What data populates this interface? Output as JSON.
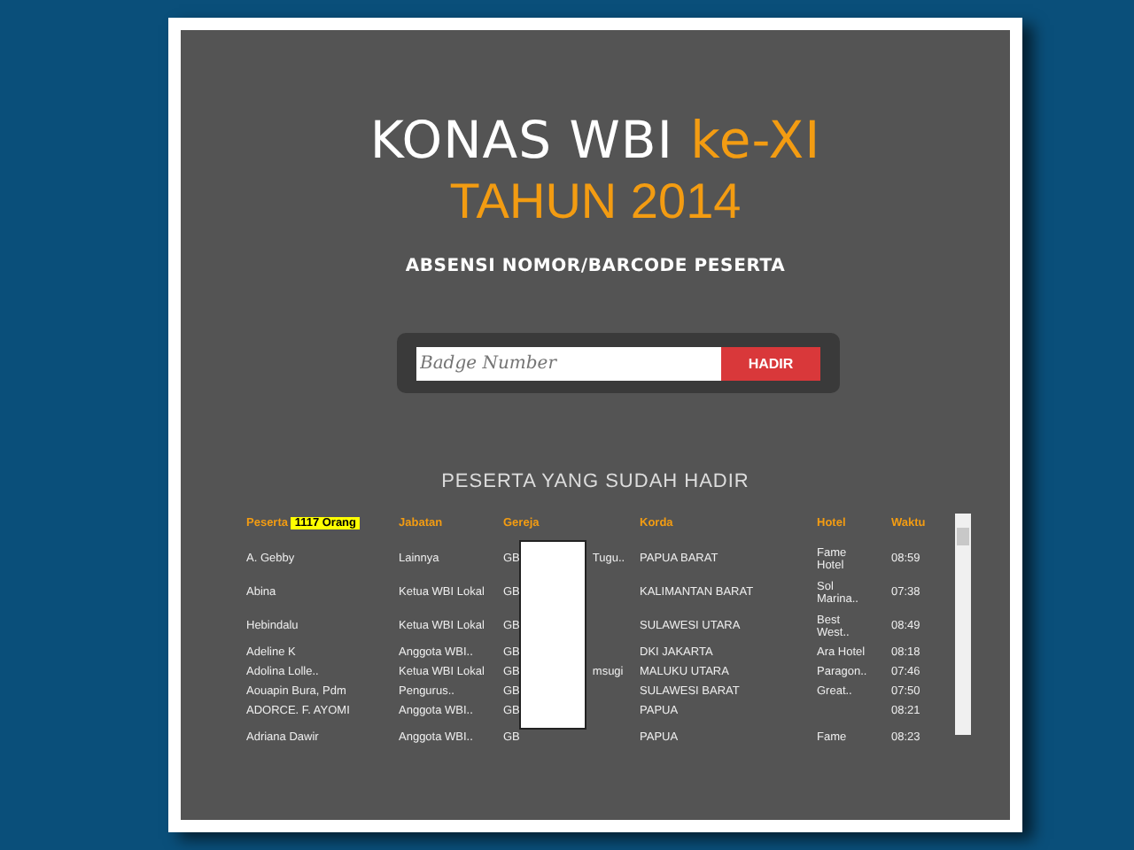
{
  "title": {
    "main": "KONAS WBI",
    "accent": "ke-XI",
    "year": "TAHUN 2014"
  },
  "subtitle": "ABSENSI NOMOR/BARCODE PESERTA",
  "search": {
    "placeholder": "Badge Number",
    "button": "HADIR"
  },
  "section_title": "PESERTA YANG SUDAH HADIR",
  "table": {
    "columns": [
      "Peserta",
      "Jabatan",
      "Gereja",
      "Korda",
      "Hotel",
      "Waktu"
    ],
    "count_badge": "1117 Orang",
    "rows": [
      {
        "peserta": "A. Gebby",
        "jabatan": "Lainnya",
        "gereja": "GB",
        "gereja_tail": "Tugu..",
        "korda": "PAPUA BARAT",
        "hotel": "Fame Hotel",
        "waktu": "08:59"
      },
      {
        "peserta": "Abina",
        "jabatan": "Ketua WBI Lokal",
        "gereja": "GB",
        "korda": "KALIMANTAN BARAT",
        "hotel": "Sol Marina..",
        "waktu": "07:38"
      },
      {
        "peserta": "Hebindalu",
        "jabatan": "Ketua WBI Lokal",
        "gereja": "GB",
        "korda": "SULAWESI UTARA",
        "hotel": "Best West..",
        "waktu": "08:49"
      },
      {
        "peserta": "Adeline K",
        "jabatan": "Anggota WBI..",
        "gereja": "GB",
        "korda": "DKI JAKARTA",
        "hotel": "Ara Hotel",
        "waktu": "08:18"
      },
      {
        "peserta": "Adolina Lolle..",
        "jabatan": "Ketua WBI Lokal",
        "gereja": "GB",
        "gereja_tail": "msugi",
        "korda": "MALUKU UTARA",
        "hotel": "Paragon..",
        "waktu": "07:46"
      },
      {
        "peserta": "Aouapin Bura, Pdm",
        "jabatan": "Pengurus..",
        "gereja": "GB",
        "korda": "SULAWESI BARAT",
        "hotel": "Great..",
        "waktu": "07:50"
      },
      {
        "peserta": "ADORCE. F. AYOMI",
        "jabatan": "Anggota WBI..",
        "gereja": "GB",
        "korda": "PAPUA",
        "waktu": "08:21"
      },
      {
        "peserta": "Adriana Dawir",
        "jabatan": "Anggota WBI..",
        "gereja": "GB",
        "korda": "PAPUA",
        "hotel": "Fame",
        "waktu": "08:23"
      }
    ]
  }
}
